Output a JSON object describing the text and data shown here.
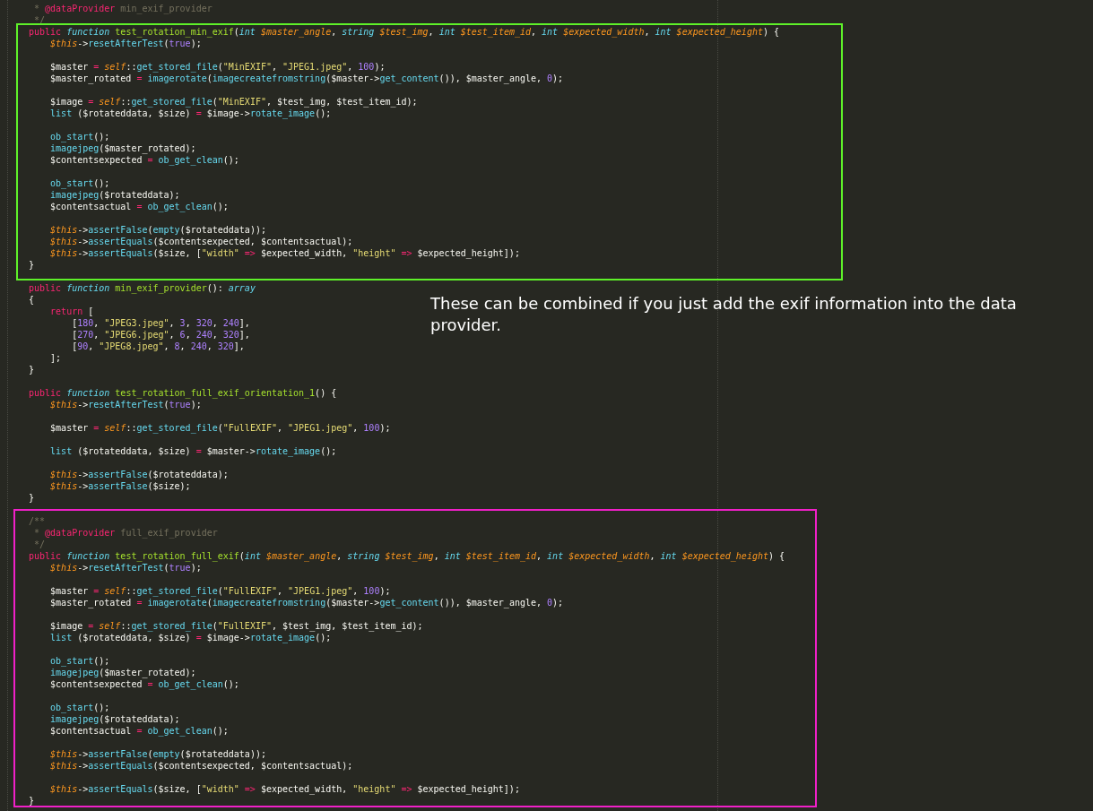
{
  "editor": {
    "sections": [
      {
        "kind": "plain",
        "lines": [
          {
            "kind": "code",
            "tokens": [
              {
                "kind": "cm",
                "text": " * "
              },
              {
                "kind": "tag",
                "text": "@dataProvider"
              },
              {
                "kind": "cm",
                "text": " min_exif_provider"
              }
            ]
          },
          {
            "kind": "code",
            "tokens": [
              {
                "kind": "cm",
                "text": " */"
              }
            ]
          }
        ]
      },
      {
        "kind": "framed",
        "color": "#5ef129",
        "lines": [
          {
            "kind": "code",
            "tokens": [
              {
                "kind": "kw",
                "text": "public "
              },
              {
                "kind": "st",
                "text": "function "
              },
              {
                "kind": "fn",
                "text": "test_rotation_min_exif"
              },
              {
                "kind": "pl",
                "text": "("
              },
              {
                "kind": "st",
                "text": "int "
              },
              {
                "kind": "par",
                "text": "$master_angle"
              },
              {
                "kind": "pl",
                "text": ", "
              },
              {
                "kind": "st",
                "text": "string "
              },
              {
                "kind": "par",
                "text": "$test_img"
              },
              {
                "kind": "pl",
                "text": ", "
              },
              {
                "kind": "st",
                "text": "int "
              },
              {
                "kind": "par",
                "text": "$test_item_id"
              },
              {
                "kind": "pl",
                "text": ", "
              },
              {
                "kind": "st",
                "text": "int "
              },
              {
                "kind": "par",
                "text": "$expected_width"
              },
              {
                "kind": "pl",
                "text": ", "
              },
              {
                "kind": "st",
                "text": "int "
              },
              {
                "kind": "par",
                "text": "$expected_height"
              },
              {
                "kind": "pl",
                "text": ") {"
              }
            ]
          },
          {
            "kind": "code",
            "tokens": [
              {
                "kind": "par",
                "text": "    $this"
              },
              {
                "kind": "pl",
                "text": "->"
              },
              {
                "kind": "call",
                "text": "resetAfterTest"
              },
              {
                "kind": "pl",
                "text": "("
              },
              {
                "kind": "con",
                "text": "true"
              },
              {
                "kind": "pl",
                "text": ");"
              }
            ]
          },
          {
            "kind": "blank"
          },
          {
            "kind": "code",
            "tokens": [
              {
                "kind": "pl",
                "text": "    $master "
              },
              {
                "kind": "op",
                "text": "= "
              },
              {
                "kind": "par",
                "text": "self"
              },
              {
                "kind": "pl",
                "text": "::"
              },
              {
                "kind": "call",
                "text": "get_stored_file"
              },
              {
                "kind": "pl",
                "text": "("
              },
              {
                "kind": "str",
                "text": "\"MinEXIF\""
              },
              {
                "kind": "pl",
                "text": ", "
              },
              {
                "kind": "str",
                "text": "\"JPEG1.jpeg\""
              },
              {
                "kind": "pl",
                "text": ", "
              },
              {
                "kind": "con",
                "text": "100"
              },
              {
                "kind": "pl",
                "text": ");"
              }
            ]
          },
          {
            "kind": "code",
            "tokens": [
              {
                "kind": "pl",
                "text": "    $master_rotated "
              },
              {
                "kind": "op",
                "text": "= "
              },
              {
                "kind": "call",
                "text": "imagerotate"
              },
              {
                "kind": "pl",
                "text": "("
              },
              {
                "kind": "call",
                "text": "imagecreatefromstring"
              },
              {
                "kind": "pl",
                "text": "($master->"
              },
              {
                "kind": "call",
                "text": "get_content"
              },
              {
                "kind": "pl",
                "text": "()), $master_angle, "
              },
              {
                "kind": "con",
                "text": "0"
              },
              {
                "kind": "pl",
                "text": ");"
              }
            ]
          },
          {
            "kind": "blank"
          },
          {
            "kind": "code",
            "tokens": [
              {
                "kind": "pl",
                "text": "    $image "
              },
              {
                "kind": "op",
                "text": "= "
              },
              {
                "kind": "par",
                "text": "self"
              },
              {
                "kind": "pl",
                "text": "::"
              },
              {
                "kind": "call",
                "text": "get_stored_file"
              },
              {
                "kind": "pl",
                "text": "("
              },
              {
                "kind": "str",
                "text": "\"MinEXIF\""
              },
              {
                "kind": "pl",
                "text": ", $test_img, $test_item_id);"
              }
            ]
          },
          {
            "kind": "code",
            "tokens": [
              {
                "kind": "call",
                "text": "    list"
              },
              {
                "kind": "pl",
                "text": " ($rotateddata, $size) "
              },
              {
                "kind": "op",
                "text": "= "
              },
              {
                "kind": "pl",
                "text": "$image->"
              },
              {
                "kind": "call",
                "text": "rotate_image"
              },
              {
                "kind": "pl",
                "text": "();"
              }
            ]
          },
          {
            "kind": "blank"
          },
          {
            "kind": "code",
            "tokens": [
              {
                "kind": "call",
                "text": "    ob_start"
              },
              {
                "kind": "pl",
                "text": "();"
              }
            ]
          },
          {
            "kind": "code",
            "tokens": [
              {
                "kind": "call",
                "text": "    imagejpeg"
              },
              {
                "kind": "pl",
                "text": "($master_rotated);"
              }
            ]
          },
          {
            "kind": "code",
            "tokens": [
              {
                "kind": "pl",
                "text": "    $contentsexpected "
              },
              {
                "kind": "op",
                "text": "= "
              },
              {
                "kind": "call",
                "text": "ob_get_clean"
              },
              {
                "kind": "pl",
                "text": "();"
              }
            ]
          },
          {
            "kind": "blank"
          },
          {
            "kind": "code",
            "tokens": [
              {
                "kind": "call",
                "text": "    ob_start"
              },
              {
                "kind": "pl",
                "text": "();"
              }
            ]
          },
          {
            "kind": "code",
            "tokens": [
              {
                "kind": "call",
                "text": "    imagejpeg"
              },
              {
                "kind": "pl",
                "text": "($rotateddata);"
              }
            ]
          },
          {
            "kind": "code",
            "tokens": [
              {
                "kind": "pl",
                "text": "    $contentsactual "
              },
              {
                "kind": "op",
                "text": "= "
              },
              {
                "kind": "call",
                "text": "ob_get_clean"
              },
              {
                "kind": "pl",
                "text": "();"
              }
            ]
          },
          {
            "kind": "blank"
          },
          {
            "kind": "code",
            "tokens": [
              {
                "kind": "par",
                "text": "    $this"
              },
              {
                "kind": "pl",
                "text": "->"
              },
              {
                "kind": "call",
                "text": "assertFalse"
              },
              {
                "kind": "pl",
                "text": "("
              },
              {
                "kind": "call",
                "text": "empty"
              },
              {
                "kind": "pl",
                "text": "($rotateddata));"
              }
            ]
          },
          {
            "kind": "code",
            "tokens": [
              {
                "kind": "par",
                "text": "    $this"
              },
              {
                "kind": "pl",
                "text": "->"
              },
              {
                "kind": "call",
                "text": "assertEquals"
              },
              {
                "kind": "pl",
                "text": "($contentsexpected, $contentsactual);"
              }
            ]
          },
          {
            "kind": "code",
            "tokens": [
              {
                "kind": "par",
                "text": "    $this"
              },
              {
                "kind": "pl",
                "text": "->"
              },
              {
                "kind": "call",
                "text": "assertEquals"
              },
              {
                "kind": "pl",
                "text": "($size, ["
              },
              {
                "kind": "str",
                "text": "\"width\""
              },
              {
                "kind": "op",
                "text": " =>"
              },
              {
                "kind": "pl",
                "text": " $expected_width, "
              },
              {
                "kind": "str",
                "text": "\"height\""
              },
              {
                "kind": "op",
                "text": " =>"
              },
              {
                "kind": "pl",
                "text": " $expected_height]);"
              }
            ]
          },
          {
            "kind": "code",
            "tokens": [
              {
                "kind": "pl",
                "text": "}"
              }
            ]
          }
        ]
      },
      {
        "kind": "plain",
        "lines": [
          {
            "kind": "blank"
          },
          {
            "kind": "code",
            "tokens": [
              {
                "kind": "kw",
                "text": "public "
              },
              {
                "kind": "st",
                "text": "function "
              },
              {
                "kind": "fn",
                "text": "min_exif_provider"
              },
              {
                "kind": "pl",
                "text": "(): "
              },
              {
                "kind": "st",
                "text": "array"
              }
            ]
          },
          {
            "kind": "code",
            "tokens": [
              {
                "kind": "pl",
                "text": "{"
              }
            ]
          },
          {
            "kind": "code",
            "tokens": [
              {
                "kind": "kw",
                "text": "    return"
              },
              {
                "kind": "pl",
                "text": " ["
              }
            ]
          },
          {
            "kind": "code",
            "tokens": [
              {
                "kind": "pl",
                "text": "        ["
              },
              {
                "kind": "con",
                "text": "180"
              },
              {
                "kind": "pl",
                "text": ", "
              },
              {
                "kind": "str",
                "text": "\"JPEG3.jpeg\""
              },
              {
                "kind": "pl",
                "text": ", "
              },
              {
                "kind": "con",
                "text": "3"
              },
              {
                "kind": "pl",
                "text": ", "
              },
              {
                "kind": "con",
                "text": "320"
              },
              {
                "kind": "pl",
                "text": ", "
              },
              {
                "kind": "con",
                "text": "240"
              },
              {
                "kind": "pl",
                "text": "],"
              }
            ]
          },
          {
            "kind": "code",
            "tokens": [
              {
                "kind": "pl",
                "text": "        ["
              },
              {
                "kind": "con",
                "text": "270"
              },
              {
                "kind": "pl",
                "text": ", "
              },
              {
                "kind": "str",
                "text": "\"JPEG6.jpeg\""
              },
              {
                "kind": "pl",
                "text": ", "
              },
              {
                "kind": "con",
                "text": "6"
              },
              {
                "kind": "pl",
                "text": ", "
              },
              {
                "kind": "con",
                "text": "240"
              },
              {
                "kind": "pl",
                "text": ", "
              },
              {
                "kind": "con",
                "text": "320"
              },
              {
                "kind": "pl",
                "text": "],"
              }
            ]
          },
          {
            "kind": "code",
            "tokens": [
              {
                "kind": "pl",
                "text": "        ["
              },
              {
                "kind": "con",
                "text": "90"
              },
              {
                "kind": "pl",
                "text": ", "
              },
              {
                "kind": "str",
                "text": "\"JPEG8.jpeg\""
              },
              {
                "kind": "pl",
                "text": ", "
              },
              {
                "kind": "con",
                "text": "8"
              },
              {
                "kind": "pl",
                "text": ", "
              },
              {
                "kind": "con",
                "text": "240"
              },
              {
                "kind": "pl",
                "text": ", "
              },
              {
                "kind": "con",
                "text": "320"
              },
              {
                "kind": "pl",
                "text": "],"
              }
            ]
          },
          {
            "kind": "code",
            "tokens": [
              {
                "kind": "pl",
                "text": "    ];"
              }
            ]
          },
          {
            "kind": "code",
            "tokens": [
              {
                "kind": "pl",
                "text": "}"
              }
            ]
          },
          {
            "kind": "blank"
          },
          {
            "kind": "code",
            "tokens": [
              {
                "kind": "kw",
                "text": "public "
              },
              {
                "kind": "st",
                "text": "function "
              },
              {
                "kind": "fn",
                "text": "test_rotation_full_exif_orientation_1"
              },
              {
                "kind": "pl",
                "text": "() {"
              }
            ]
          },
          {
            "kind": "code",
            "tokens": [
              {
                "kind": "par",
                "text": "    $this"
              },
              {
                "kind": "pl",
                "text": "->"
              },
              {
                "kind": "call",
                "text": "resetAfterTest"
              },
              {
                "kind": "pl",
                "text": "("
              },
              {
                "kind": "con",
                "text": "true"
              },
              {
                "kind": "pl",
                "text": ");"
              }
            ]
          },
          {
            "kind": "blank"
          },
          {
            "kind": "code",
            "tokens": [
              {
                "kind": "pl",
                "text": "    $master "
              },
              {
                "kind": "op",
                "text": "= "
              },
              {
                "kind": "par",
                "text": "self"
              },
              {
                "kind": "pl",
                "text": "::"
              },
              {
                "kind": "call",
                "text": "get_stored_file"
              },
              {
                "kind": "pl",
                "text": "("
              },
              {
                "kind": "str",
                "text": "\"FullEXIF\""
              },
              {
                "kind": "pl",
                "text": ", "
              },
              {
                "kind": "str",
                "text": "\"JPEG1.jpeg\""
              },
              {
                "kind": "pl",
                "text": ", "
              },
              {
                "kind": "con",
                "text": "100"
              },
              {
                "kind": "pl",
                "text": ");"
              }
            ]
          },
          {
            "kind": "blank"
          },
          {
            "kind": "code",
            "tokens": [
              {
                "kind": "call",
                "text": "    list"
              },
              {
                "kind": "pl",
                "text": " ($rotateddata, $size) "
              },
              {
                "kind": "op",
                "text": "= "
              },
              {
                "kind": "pl",
                "text": "$master->"
              },
              {
                "kind": "call",
                "text": "rotate_image"
              },
              {
                "kind": "pl",
                "text": "();"
              }
            ]
          },
          {
            "kind": "blank"
          },
          {
            "kind": "code",
            "tokens": [
              {
                "kind": "par",
                "text": "    $this"
              },
              {
                "kind": "pl",
                "text": "->"
              },
              {
                "kind": "call",
                "text": "assertFalse"
              },
              {
                "kind": "pl",
                "text": "($rotateddata);"
              }
            ]
          },
          {
            "kind": "code",
            "tokens": [
              {
                "kind": "par",
                "text": "    $this"
              },
              {
                "kind": "pl",
                "text": "->"
              },
              {
                "kind": "call",
                "text": "assertFalse"
              },
              {
                "kind": "pl",
                "text": "($size);"
              }
            ]
          },
          {
            "kind": "code",
            "tokens": [
              {
                "kind": "pl",
                "text": "}"
              }
            ]
          },
          {
            "kind": "blank"
          }
        ]
      },
      {
        "kind": "framed",
        "color": "#f020c8",
        "lines": [
          {
            "kind": "code",
            "tokens": [
              {
                "kind": "cm",
                "text": "/**"
              }
            ]
          },
          {
            "kind": "code",
            "tokens": [
              {
                "kind": "cm",
                "text": " * "
              },
              {
                "kind": "tag",
                "text": "@dataProvider"
              },
              {
                "kind": "cm",
                "text": " full_exif_provider"
              }
            ]
          },
          {
            "kind": "code",
            "tokens": [
              {
                "kind": "cm",
                "text": " */"
              }
            ]
          },
          {
            "kind": "code",
            "tokens": [
              {
                "kind": "kw",
                "text": "public "
              },
              {
                "kind": "st",
                "text": "function "
              },
              {
                "kind": "fn",
                "text": "test_rotation_full_exif"
              },
              {
                "kind": "pl",
                "text": "("
              },
              {
                "kind": "st",
                "text": "int "
              },
              {
                "kind": "par",
                "text": "$master_angle"
              },
              {
                "kind": "pl",
                "text": ", "
              },
              {
                "kind": "st",
                "text": "string "
              },
              {
                "kind": "par",
                "text": "$test_img"
              },
              {
                "kind": "pl",
                "text": ", "
              },
              {
                "kind": "st",
                "text": "int "
              },
              {
                "kind": "par",
                "text": "$test_item_id"
              },
              {
                "kind": "pl",
                "text": ", "
              },
              {
                "kind": "st",
                "text": "int "
              },
              {
                "kind": "par",
                "text": "$expected_width"
              },
              {
                "kind": "pl",
                "text": ", "
              },
              {
                "kind": "st",
                "text": "int "
              },
              {
                "kind": "par",
                "text": "$expected_height"
              },
              {
                "kind": "pl",
                "text": ") {"
              }
            ]
          },
          {
            "kind": "code",
            "tokens": [
              {
                "kind": "par",
                "text": "    $this"
              },
              {
                "kind": "pl",
                "text": "->"
              },
              {
                "kind": "call",
                "text": "resetAfterTest"
              },
              {
                "kind": "pl",
                "text": "("
              },
              {
                "kind": "con",
                "text": "true"
              },
              {
                "kind": "pl",
                "text": ");"
              }
            ]
          },
          {
            "kind": "blank"
          },
          {
            "kind": "code",
            "tokens": [
              {
                "kind": "pl",
                "text": "    $master "
              },
              {
                "kind": "op",
                "text": "= "
              },
              {
                "kind": "par",
                "text": "self"
              },
              {
                "kind": "pl",
                "text": "::"
              },
              {
                "kind": "call",
                "text": "get_stored_file"
              },
              {
                "kind": "pl",
                "text": "("
              },
              {
                "kind": "str",
                "text": "\"FullEXIF\""
              },
              {
                "kind": "pl",
                "text": ", "
              },
              {
                "kind": "str",
                "text": "\"JPEG1.jpeg\""
              },
              {
                "kind": "pl",
                "text": ", "
              },
              {
                "kind": "con",
                "text": "100"
              },
              {
                "kind": "pl",
                "text": ");"
              }
            ]
          },
          {
            "kind": "code",
            "tokens": [
              {
                "kind": "pl",
                "text": "    $master_rotated "
              },
              {
                "kind": "op",
                "text": "= "
              },
              {
                "kind": "call",
                "text": "imagerotate"
              },
              {
                "kind": "pl",
                "text": "("
              },
              {
                "kind": "call",
                "text": "imagecreatefromstring"
              },
              {
                "kind": "pl",
                "text": "($master->"
              },
              {
                "kind": "call",
                "text": "get_content"
              },
              {
                "kind": "pl",
                "text": "()), $master_angle, "
              },
              {
                "kind": "con",
                "text": "0"
              },
              {
                "kind": "pl",
                "text": ");"
              }
            ]
          },
          {
            "kind": "blank"
          },
          {
            "kind": "code",
            "tokens": [
              {
                "kind": "pl",
                "text": "    $image "
              },
              {
                "kind": "op",
                "text": "= "
              },
              {
                "kind": "par",
                "text": "self"
              },
              {
                "kind": "pl",
                "text": "::"
              },
              {
                "kind": "call",
                "text": "get_stored_file"
              },
              {
                "kind": "pl",
                "text": "("
              },
              {
                "kind": "str",
                "text": "\"FullEXIF\""
              },
              {
                "kind": "pl",
                "text": ", $test_img, $test_item_id);"
              }
            ]
          },
          {
            "kind": "code",
            "tokens": [
              {
                "kind": "call",
                "text": "    list"
              },
              {
                "kind": "pl",
                "text": " ($rotateddata, $size) "
              },
              {
                "kind": "op",
                "text": "= "
              },
              {
                "kind": "pl",
                "text": "$image->"
              },
              {
                "kind": "call",
                "text": "rotate_image"
              },
              {
                "kind": "pl",
                "text": "();"
              }
            ]
          },
          {
            "kind": "blank"
          },
          {
            "kind": "code",
            "tokens": [
              {
                "kind": "call",
                "text": "    ob_start"
              },
              {
                "kind": "pl",
                "text": "();"
              }
            ]
          },
          {
            "kind": "code",
            "tokens": [
              {
                "kind": "call",
                "text": "    imagejpeg"
              },
              {
                "kind": "pl",
                "text": "($master_rotated);"
              }
            ]
          },
          {
            "kind": "code",
            "tokens": [
              {
                "kind": "pl",
                "text": "    $contentsexpected "
              },
              {
                "kind": "op",
                "text": "= "
              },
              {
                "kind": "call",
                "text": "ob_get_clean"
              },
              {
                "kind": "pl",
                "text": "();"
              }
            ]
          },
          {
            "kind": "blank"
          },
          {
            "kind": "code",
            "tokens": [
              {
                "kind": "call",
                "text": "    ob_start"
              },
              {
                "kind": "pl",
                "text": "();"
              }
            ]
          },
          {
            "kind": "code",
            "tokens": [
              {
                "kind": "call",
                "text": "    imagejpeg"
              },
              {
                "kind": "pl",
                "text": "($rotateddata);"
              }
            ]
          },
          {
            "kind": "code",
            "tokens": [
              {
                "kind": "pl",
                "text": "    $contentsactual "
              },
              {
                "kind": "op",
                "text": "= "
              },
              {
                "kind": "call",
                "text": "ob_get_clean"
              },
              {
                "kind": "pl",
                "text": "();"
              }
            ]
          },
          {
            "kind": "blank"
          },
          {
            "kind": "code",
            "tokens": [
              {
                "kind": "par",
                "text": "    $this"
              },
              {
                "kind": "pl",
                "text": "->"
              },
              {
                "kind": "call",
                "text": "assertFalse"
              },
              {
                "kind": "pl",
                "text": "("
              },
              {
                "kind": "call",
                "text": "empty"
              },
              {
                "kind": "pl",
                "text": "($rotateddata));"
              }
            ]
          },
          {
            "kind": "code",
            "tokens": [
              {
                "kind": "par",
                "text": "    $this"
              },
              {
                "kind": "pl",
                "text": "->"
              },
              {
                "kind": "call",
                "text": "assertEquals"
              },
              {
                "kind": "pl",
                "text": "($contentsexpected, $contentsactual);"
              }
            ]
          },
          {
            "kind": "blank"
          },
          {
            "kind": "code",
            "tokens": [
              {
                "kind": "par",
                "text": "    $this"
              },
              {
                "kind": "pl",
                "text": "->"
              },
              {
                "kind": "call",
                "text": "assertEquals"
              },
              {
                "kind": "pl",
                "text": "($size, ["
              },
              {
                "kind": "str",
                "text": "\"width\""
              },
              {
                "kind": "op",
                "text": " =>"
              },
              {
                "kind": "pl",
                "text": " $expected_width, "
              },
              {
                "kind": "str",
                "text": "\"height\""
              },
              {
                "kind": "op",
                "text": " =>"
              },
              {
                "kind": "pl",
                "text": " $expected_height]);"
              }
            ]
          },
          {
            "kind": "code",
            "tokens": [
              {
                "kind": "pl",
                "text": "}"
              }
            ]
          }
        ]
      }
    ]
  },
  "annotation": {
    "text": "These can be combined if you just add the exif information into the data provider."
  }
}
